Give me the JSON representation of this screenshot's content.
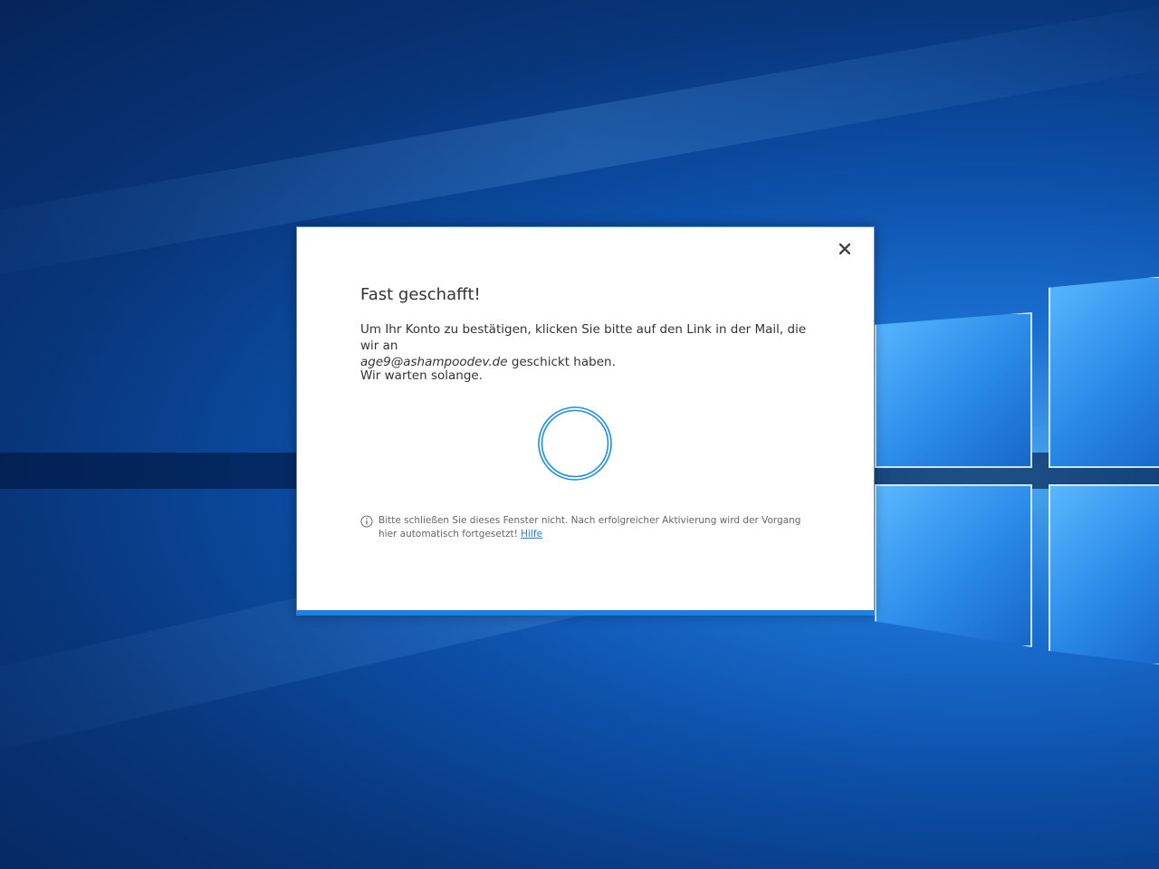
{
  "dialog": {
    "title": "Fast geschafft!",
    "message_before_email": "Um Ihr Konto zu bestätigen, klicken Sie bitte auf den Link in der Mail, die wir an",
    "email": "age9@ashampoodev.de",
    "message_after_email": "geschickt haben.",
    "wait_text": "Wir warten solange.",
    "note_text": "Bitte schließen Sie dieses Fenster nicht. Nach erfolgreicher Aktivierung wird der Vorgang hier automatisch fortgesetzt!",
    "help_link": "Hilfe",
    "close_icon": "close-icon",
    "info_icon": "info-icon",
    "spinner_icon": "loading-spinner"
  },
  "colors": {
    "accent": "#1b82e3",
    "text": "#333333",
    "muted_text": "#666666",
    "dialog_background": "#ffffff"
  }
}
